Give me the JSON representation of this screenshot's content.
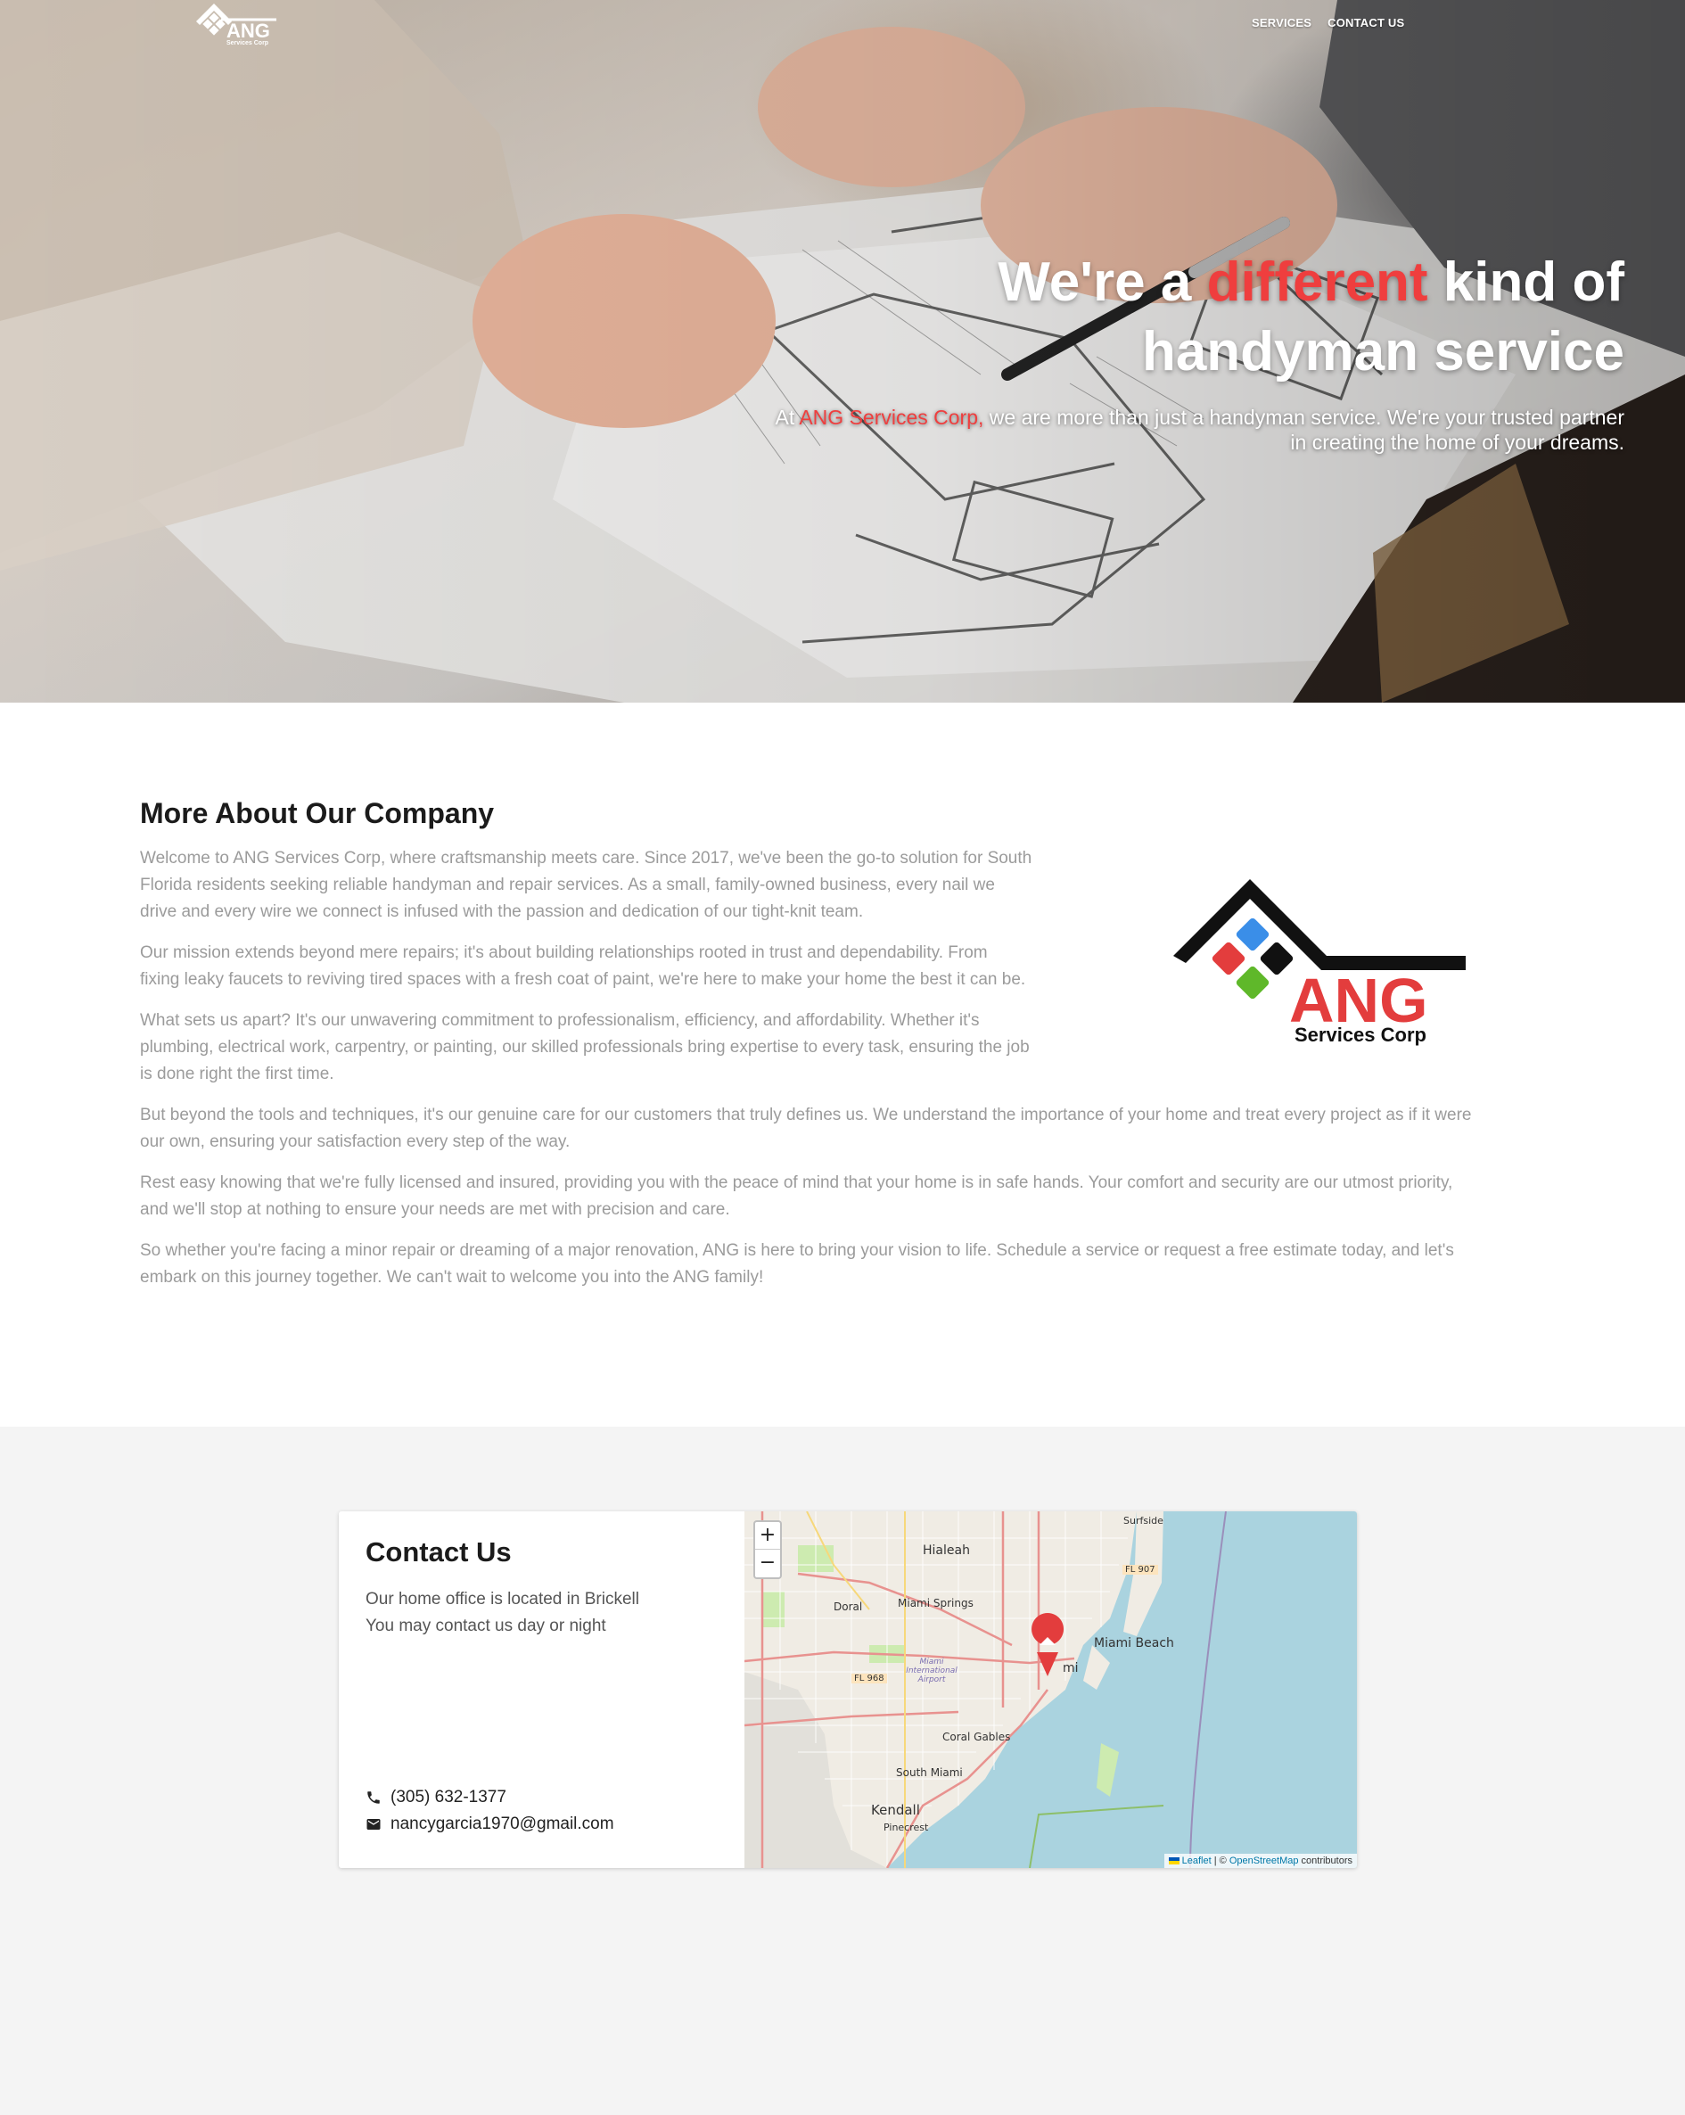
{
  "nav": {
    "logo_text": "ANG",
    "logo_sub": "Services Corp",
    "links": [
      "SERVICES",
      "CONTACT US"
    ]
  },
  "hero": {
    "title_part1": "We're a ",
    "title_accent": "different",
    "title_part2": " kind of",
    "title_line2": "handyman service",
    "sub_part1": "At ",
    "sub_accent": "ANG Services Corp,",
    "sub_part2": " we are more than just a handyman service. We're your trusted partner",
    "sub_line2": "in creating the home of your dreams.",
    "accent_color": "#ef3e3e"
  },
  "about": {
    "title": "More About Our Company",
    "paragraphs": [
      [
        "Welcome to ANG Services Corp, where craftsmanship meets care. Since 2017, we've been the go-to solution for South",
        "Florida residents seeking reliable handyman and repair services. As a small, family-owned business, every nail we",
        "drive and every wire we connect is infused with the passion and dedication of our tight-knit team."
      ],
      [
        "Our mission extends beyond mere repairs; it's about building relationships rooted in trust and dependability. From",
        "fixing leaky faucets to reviving tired spaces with a fresh coat of paint, we're here to make your home the best it can be."
      ],
      [
        "What sets us apart? It's our unwavering commitment to professionalism, efficiency, and affordability. Whether it's",
        "plumbing, electrical work, carpentry, or painting, our skilled professionals bring expertise to every task, ensuring the job",
        "is done right the first time."
      ],
      [
        "But beyond the tools and techniques, it's our genuine care for our customers that truly defines us. We understand the importance of your home and treat every project as if it were",
        "our own, ensuring your satisfaction every step of the way."
      ],
      [
        "Rest easy knowing that we're fully licensed and insured, providing you with the peace of mind that your home is in safe hands. Your comfort and security are our utmost priority,",
        "and we'll stop at nothing to ensure your needs are met with precision and care."
      ],
      [
        "So whether you're facing a minor repair or dreaming of a major renovation, ANG is here to bring your vision to life. Schedule a service or request a free estimate today, and let's",
        "embark on this journey together. We can't wait to welcome you into the ANG family!"
      ]
    ],
    "logo_text": "ANG",
    "logo_sub": "Services Corp"
  },
  "contact": {
    "title": "Contact Us",
    "line1": "Our home office is located in Brickell",
    "line2": "You may contact us day or night",
    "phone": "(305) 632-1377",
    "email": "nancygarcia1970@gmail.com"
  },
  "map": {
    "zoom_in": "+",
    "zoom_out": "−",
    "labels": {
      "surfside": "Surfside",
      "fl907": "FL 907",
      "hialeah": "Hialeah",
      "doral": "Doral",
      "miami_springs": "Miami Springs",
      "miami_beach": "Miami Beach",
      "airport": "Miami International Airport",
      "fl968": "FL 968",
      "coral_gables": "Coral Gables",
      "south_miami": "South Miami",
      "kendall": "Kendall",
      "pinecrest": "Pinecrest",
      "miami": "mi"
    },
    "attribution_leaflet": "Leaflet",
    "attribution_sep": " | © ",
    "attribution_osm": "OpenStreetMap",
    "attribution_tail": " contributors"
  }
}
